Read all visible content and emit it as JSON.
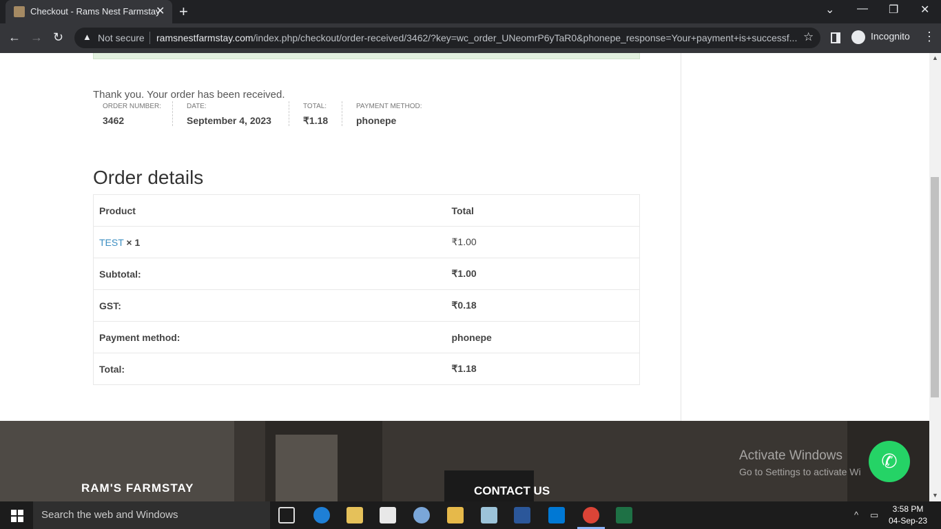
{
  "browser": {
    "tab_title": "Checkout - Rams Nest Farmstay",
    "security_label": "Not secure",
    "url_host": "ramsnestfarmstay.com",
    "url_path": "/index.php/checkout/order-received/3462/?key=wc_order_UNeomrP6yTaR0&phonepe_response=Your+payment+is+successf...",
    "profile_label": "Incognito"
  },
  "order": {
    "thanks": "Thank you. Your order has been received.",
    "number_label": "ORDER NUMBER:",
    "number": "3462",
    "date_label": "DATE:",
    "date": "September 4, 2023",
    "total_label": "TOTAL:",
    "total": "₹1.18",
    "method_label": "PAYMENT METHOD:",
    "method": "phonepe"
  },
  "details": {
    "heading": "Order details",
    "col_product": "Product",
    "col_total": "Total",
    "item_name": "TEST",
    "item_qty": "× 1",
    "item_total": "₹1.00",
    "rows": [
      {
        "label": "Subtotal:",
        "value": "₹1.00"
      },
      {
        "label": "GST:",
        "value": "₹0.18"
      },
      {
        "label": "Payment method:",
        "value": "phonepe"
      },
      {
        "label": "Total:",
        "value": "₹1.18"
      }
    ]
  },
  "footer": {
    "brand": "RAM'S FARMSTAY",
    "contact": "CONTACT US"
  },
  "watermark": {
    "line1": "Activate Windows",
    "line2": "Go to Settings to activate Wi"
  },
  "taskbar": {
    "search_placeholder": "Search the web and Windows",
    "time": "3:58 PM",
    "date": "04-Sep-23"
  },
  "colors": {
    "link": "#3b8ec2",
    "whatsapp": "#25d366",
    "notice_bg": "#e2f0df"
  }
}
